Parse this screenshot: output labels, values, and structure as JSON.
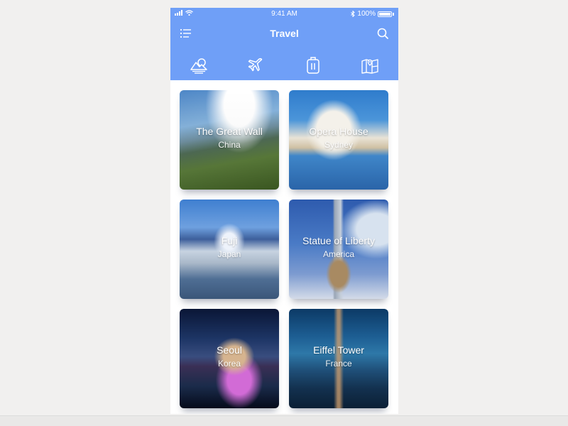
{
  "status_bar": {
    "time": "9:41 AM",
    "battery": "100%",
    "icons": [
      "signal-icon",
      "wifi-icon",
      "bluetooth-icon",
      "battery-icon"
    ]
  },
  "nav": {
    "title": "Travel",
    "left_icon": "menu-icon",
    "right_icon": "search-icon"
  },
  "categories": [
    {
      "icon": "scenery-icon"
    },
    {
      "icon": "airplane-icon"
    },
    {
      "icon": "luggage-icon"
    },
    {
      "icon": "map-icon"
    }
  ],
  "destinations": [
    {
      "name": "The Great Wall",
      "place": "China"
    },
    {
      "name": "Opera House",
      "place": "Sydney"
    },
    {
      "name": "Fuji",
      "place": "Japan"
    },
    {
      "name": "Statue of Liberty",
      "place": "America"
    },
    {
      "name": "Seoul",
      "place": "Korea"
    },
    {
      "name": "Eiffel Tower",
      "place": "France"
    }
  ],
  "colors": {
    "header": "#6f9ff7",
    "background": "#f1f0ef",
    "card_text": "#ffffff"
  }
}
